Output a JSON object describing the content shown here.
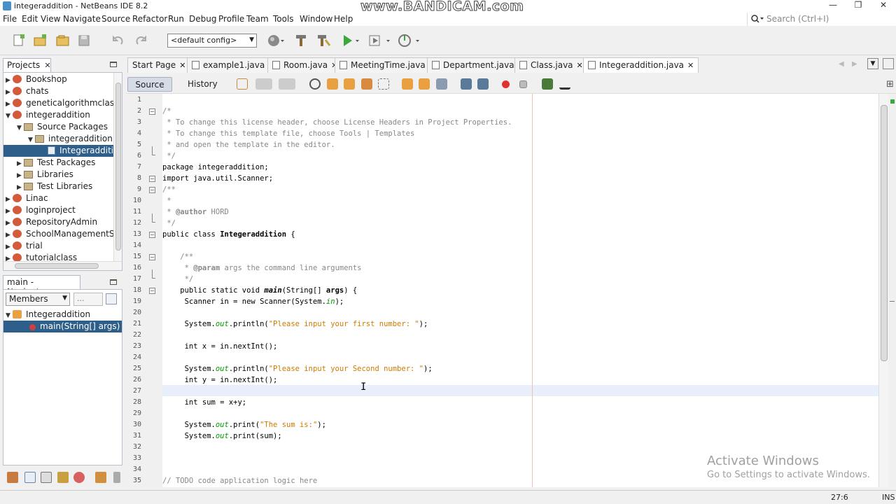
{
  "window": {
    "title": "integeraddition - NetBeans IDE 8.2",
    "watermark": "www.BANDICAM.com",
    "controls": [
      "—",
      "❐",
      "✕"
    ]
  },
  "menu": {
    "items": [
      "File",
      "Edit",
      "View",
      "Navigate",
      "Source",
      "Refactor",
      "Run",
      "Debug",
      "Profile",
      "Team",
      "Tools",
      "Window",
      "Help"
    ]
  },
  "search": {
    "placeholder": "Search (Ctrl+I)"
  },
  "toolbar": {
    "config": "<default config>"
  },
  "projects": {
    "tab_label": "Projects",
    "close": "✕",
    "items": [
      {
        "label": "Bookshop",
        "type": "project",
        "expanded": false
      },
      {
        "label": "chats",
        "type": "project",
        "expanded": false
      },
      {
        "label": "geneticalgorithmclass",
        "type": "project",
        "expanded": false
      },
      {
        "label": "integeraddition",
        "type": "project",
        "expanded": true
      },
      {
        "label": "Source Packages",
        "type": "folder",
        "expanded": true
      },
      {
        "label": "integeraddition",
        "type": "package",
        "expanded": true
      },
      {
        "label": "Integeradditio",
        "type": "file",
        "selected": true
      },
      {
        "label": "Test Packages",
        "type": "folder",
        "expanded": false
      },
      {
        "label": "Libraries",
        "type": "folder",
        "expanded": false
      },
      {
        "label": "Test Libraries",
        "type": "folder",
        "expanded": false
      },
      {
        "label": "Linac",
        "type": "project",
        "expanded": false
      },
      {
        "label": "loginproject",
        "type": "project",
        "expanded": false
      },
      {
        "label": "RepositoryAdmin",
        "type": "project",
        "expanded": false
      },
      {
        "label": "SchoolManagementSy",
        "type": "project",
        "expanded": false
      },
      {
        "label": "trial",
        "type": "project",
        "expanded": false
      },
      {
        "label": "tutorialclass",
        "type": "project",
        "expanded": false
      }
    ]
  },
  "navigator": {
    "tab_label": "main - Navigator",
    "close": "✕",
    "filter": "Members",
    "filter2": "...",
    "items": [
      {
        "label": "Integeraddition"
      },
      {
        "label": "main(String[] args)",
        "selected": true
      }
    ]
  },
  "editor": {
    "tabs": [
      {
        "label": "Start Page"
      },
      {
        "label": "example1.java"
      },
      {
        "label": "Room.java"
      },
      {
        "label": "MeetingTime.java"
      },
      {
        "label": "Department.java"
      },
      {
        "label": "Class.java"
      },
      {
        "label": "Integeraddition.java",
        "active": true
      }
    ],
    "modes": {
      "source": "Source",
      "history": "History"
    },
    "lines": [
      "",
      "/*",
      " * To change this license header, choose License Headers in Project Properties.",
      " * To change this template file, choose Tools | Templates",
      " * and open the template in the editor.",
      " */",
      "package integeraddition;",
      "import java.util.Scanner;",
      "/**",
      " *",
      " * @author HORD",
      " */",
      "public class Integeraddition {",
      "",
      "    /**",
      "     * @param args the command line arguments",
      "     */",
      "    public static void main(String[] args) {",
      "     Scanner in = new Scanner(System.in);",
      "",
      "     System.out.println(\"Please input your first number: \");",
      "",
      "     int x = in.nextInt();",
      "",
      "     System.out.println(\"Please input your Second number: \");",
      "     int y = in.nextInt();",
      "",
      "     int sum = x+y;",
      "",
      "     System.out.print(\"The sum is:\");",
      "     System.out.print(sum);",
      "",
      "",
      "",
      "// TODO code application logic here"
    ]
  },
  "activate": {
    "line1": "Activate Windows",
    "line2": "Go to Settings to activate Windows."
  },
  "status": {
    "position": "27:6",
    "mode": "INS"
  }
}
